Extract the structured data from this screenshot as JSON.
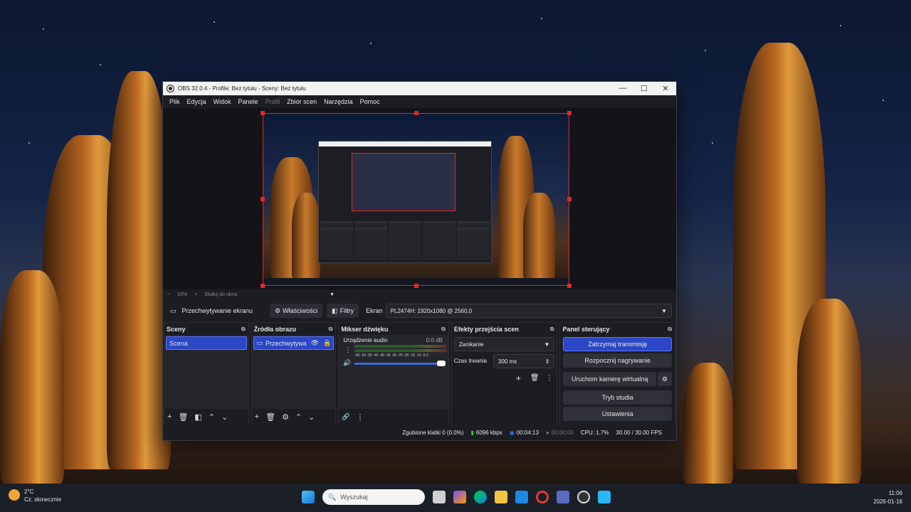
{
  "window": {
    "title": "OBS 32.0.4 - Profile: Bez tytułu - Sceny: Bez tytułu",
    "controls": {
      "minimize": "—",
      "maximize": "☐",
      "close": "✕"
    }
  },
  "menu": [
    "Plik",
    "Edycja",
    "Widok",
    "Panele",
    "Profil",
    "Zbiór scen",
    "Narzędzia",
    "Pomoc"
  ],
  "zoom": {
    "minus": "−",
    "percent": "33%",
    "plus": "+",
    "mode": "Skaluj do okna"
  },
  "source_bar": {
    "source_name": "Przechwytywanie ekranu",
    "properties": "Właściwości",
    "filters": "Filtry",
    "screen_label": "Ekran",
    "screen_value": "PL2474H: 1920x1080 @ 2560,0"
  },
  "scenes": {
    "title": "Sceny",
    "items": [
      "Scena"
    ]
  },
  "sources": {
    "title": "Źródła obrazu",
    "items": [
      "Przechwytywa"
    ]
  },
  "mixer": {
    "title": "Mikser dźwięku",
    "device": "Urządzenie audio",
    "db": "0.0 dB",
    "scale": "-60 -55 -50 -45 -40 -35 -30 -25 -20 -15 -10 -5 0"
  },
  "transitions": {
    "title": "Efekty przejścia scen",
    "selected": "Zanikanie",
    "duration_label": "Czas trwania",
    "duration_value": "300 ms"
  },
  "controls": {
    "title": "Panel sterujący",
    "stop_stream": "Zatrzymaj transmisję",
    "start_record": "Rozpocznij nagrywanie",
    "virtual_cam": "Uruchom kamerę wirtualną",
    "studio": "Tryb studia",
    "settings": "Ustawienia"
  },
  "status": {
    "dropped": "Zgubione klatki 0 (0.0%)",
    "bitrate": "6096 kbps",
    "stream_time": "00:04:13",
    "rec_time": "00:00:00",
    "cpu": "CPU: 1.7%",
    "fps": "30.00 / 30.00 FPS"
  },
  "taskbar": {
    "temp": "2°C",
    "weather": "Cz. słonecznie",
    "search_placeholder": "Wyszukaj",
    "time": "11:06",
    "date": "2026-01-16",
    "weather_badge": "2"
  },
  "colors": {
    "accent": "#2b47c6",
    "selection_border": "#e3262d",
    "stream_ok": "#3ec43e"
  }
}
